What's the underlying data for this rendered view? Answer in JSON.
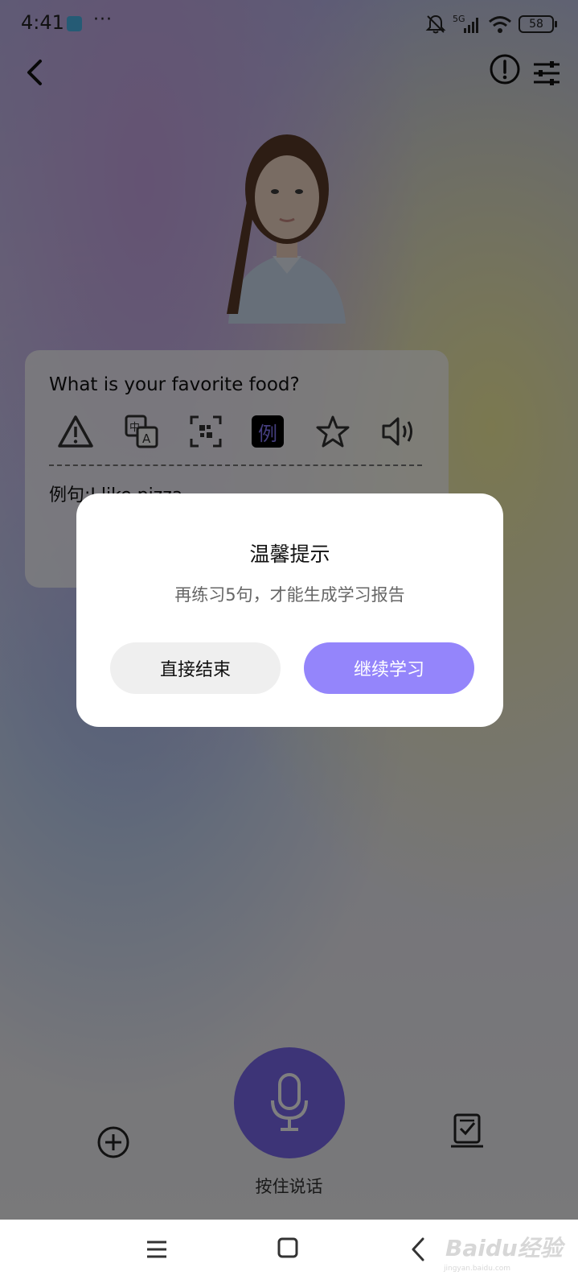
{
  "status_bar": {
    "time": "4:41",
    "dots": "···",
    "network": "5G",
    "battery": "58"
  },
  "question_card": {
    "question": "What is your favorite food?",
    "tools": [
      {
        "icon": "warning-icon"
      },
      {
        "icon": "translate-icon"
      },
      {
        "icon": "scan-icon"
      },
      {
        "icon": "example-icon",
        "label": "例"
      },
      {
        "icon": "star-icon"
      },
      {
        "icon": "speaker-icon"
      }
    ],
    "example_sentence": "例句:I like pizza."
  },
  "bottom_controls": {
    "mic_label": "按住说话"
  },
  "dialog": {
    "title": "温馨提示",
    "message": "再练习5句，才能生成学习报告",
    "end_button": "直接结束",
    "continue_button": "继续学习"
  },
  "watermark": {
    "main": "Baidu经验",
    "sub": "jingyan.baidu.com"
  },
  "colors": {
    "accent": "#9485fb",
    "mic": "#7a68ee",
    "overlay": "rgba(0,0,0,0.5)"
  }
}
